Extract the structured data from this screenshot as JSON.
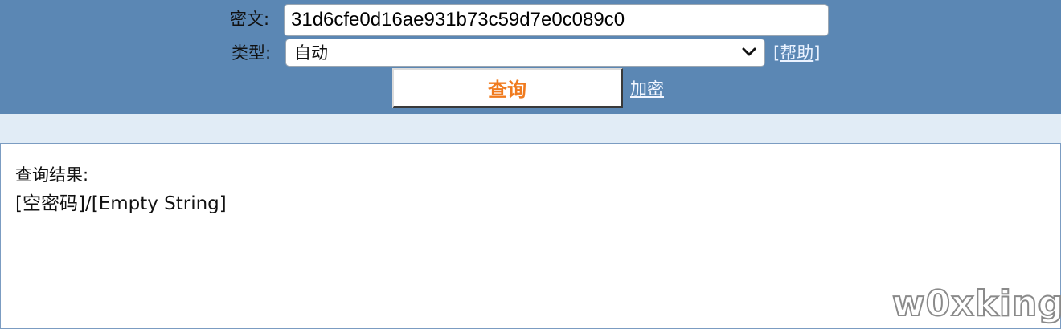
{
  "form": {
    "cipher_label": "密文:",
    "cipher_value": "31d6cfe0d16ae931b73c59d7e0c089c0",
    "type_label": "类型:",
    "type_selected": "自动",
    "help_open": "[",
    "help_text": "帮助",
    "help_close": "]",
    "query_button": "查询",
    "encrypt_link": "加密"
  },
  "result": {
    "title": "查询结果:",
    "value": "[空密码]/[Empty String]"
  },
  "watermark": "w0xking",
  "colors": {
    "topbar": "#5b87b4",
    "subbar": "#e1ecf6",
    "query_text": "#f07b1f"
  }
}
